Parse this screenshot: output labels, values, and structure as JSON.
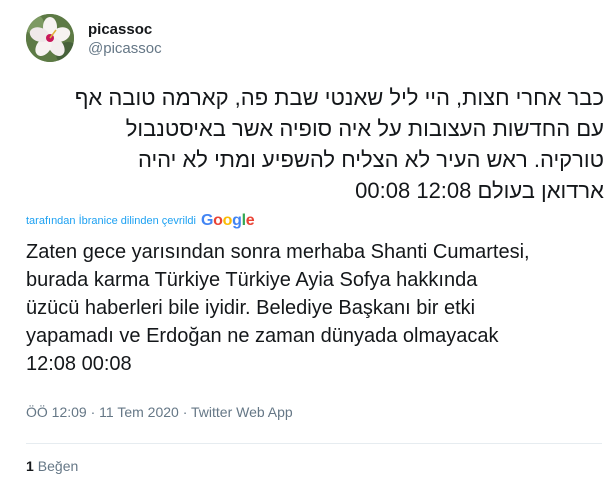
{
  "user": {
    "display_name": "picassoc",
    "handle": "@picassoc"
  },
  "tweet": {
    "original_lines": [
      "כבר אחרי חצות, היי ליל שאנטי שבת פה, קארמה טובה אף",
      "עם החדשות העצובות על איה סופיה אשר באיסטנבול",
      "טורקיה. ראש העיר לא הצליח להשפיע ומתי לא יהיה",
      "ארדואן בעולם 12:08 00:08"
    ],
    "translate_notice": "tarafından İbranice dilinden çevrildi",
    "translate_brand": "Google",
    "translated_lines": [
      "Zaten gece yarısından sonra merhaba Shanti Cumartesi,",
      "burada karma Türkiye Türkiye Ayia Sofya hakkında",
      "üzücü haberleri bile iyidir. Belediye Başkanı bir etki",
      "yapamadı ve Erdoğan ne zaman dünyada olmayacak",
      "12:08 00:08"
    ]
  },
  "meta": {
    "time": "ÖÖ 12:09",
    "separator": "·",
    "date": "11 Tem 2020",
    "source": "Twitter Web App"
  },
  "stats": {
    "like_count": "1",
    "like_label": "Beğen"
  },
  "colors": {
    "google_blue": "#4285f4",
    "google_red": "#ea4335",
    "google_yellow": "#fbbc05",
    "google_green": "#34a853",
    "link": "#1da1f2"
  }
}
